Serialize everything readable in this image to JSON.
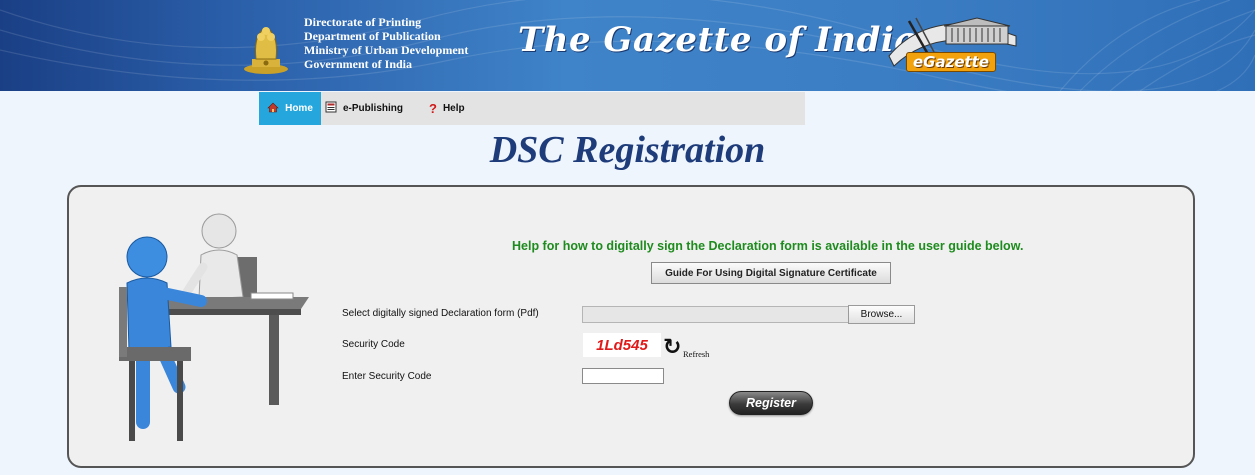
{
  "header": {
    "org_lines": [
      "Directorate of Printing",
      "Department of Publication",
      "Ministry of Urban Development",
      "Government of India"
    ],
    "title": "The Gazette of India",
    "logo_badge": "eGazette",
    "colors": {
      "banner": "#2a5ea8",
      "accent": "#f2a20c"
    }
  },
  "nav": {
    "items": [
      {
        "label": "Home",
        "icon": "home-icon",
        "active": true
      },
      {
        "label": "e-Publishing",
        "icon": "document-icon",
        "active": false
      },
      {
        "label": "Help",
        "icon": "question-icon",
        "active": false
      }
    ]
  },
  "page": {
    "title": "DSC Registration"
  },
  "form": {
    "help_text": "Help for how to digitally sign the Declaration form is available in the user guide below.",
    "guide_button": "Guide For Using Digital Signature Certificate",
    "file_label": "Select digitally signed Declaration form (Pdf)",
    "file_value": "",
    "browse_label": "Browse...",
    "security_label": "Security Code",
    "captcha_text": "1Ld545",
    "refresh_label": "Refresh",
    "enter_code_label": "Enter Security Code",
    "enter_code_value": "",
    "register_label": "Register"
  }
}
